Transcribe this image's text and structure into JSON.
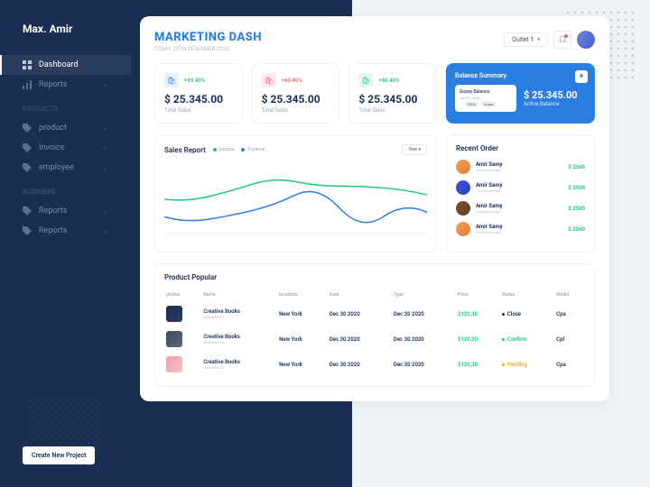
{
  "user": "Max. Amir",
  "nav": {
    "dashboard": "Dashboard",
    "reports1": "Reports",
    "sec_products": "PRODUCTS",
    "product": "product",
    "invoice": "Invoice",
    "employee": "employee",
    "sec_business": "BUSINESS",
    "reports2": "Reports",
    "reports3": "Reports",
    "new_project": "Create New Project"
  },
  "header": {
    "title": "MARKETING DASH",
    "subtitle": "TODAY, 29TH DESEMBER 2020",
    "outlet": "Outlet 1"
  },
  "stats": [
    {
      "pct": "+45.40%",
      "val": "$ 25.345.00",
      "lbl": "Total Sales"
    },
    {
      "pct": "+60.40%",
      "val": "$ 25.345.00",
      "lbl": "Total Sales"
    },
    {
      "pct": "+40.40%",
      "val": "$ 25.345.00",
      "lbl": "Total Sales"
    }
  ],
  "balance": {
    "title": "Balance Summary",
    "mini_title": "Gopay Balance",
    "mini_date": "Jan 01, 2020",
    "mini_chip1": "2500",
    "mini_chip2": "Gopay",
    "value": "$ 25.345.00",
    "label": "Active Balance"
  },
  "chart": {
    "title": "Sales Report",
    "leg1": "Income",
    "leg2": "Expense",
    "year": "Year"
  },
  "chart_data": {
    "type": "line",
    "x": [
      0,
      1,
      2,
      3,
      4,
      5,
      6,
      7,
      8,
      9,
      10,
      11
    ],
    "series": [
      {
        "name": "Income",
        "values": [
          40,
          38,
          45,
          52,
          62,
          60,
          65,
          63,
          60,
          55,
          58,
          50
        ]
      },
      {
        "name": "Expense",
        "values": [
          20,
          15,
          18,
          25,
          28,
          38,
          45,
          35,
          28,
          20,
          30,
          25
        ]
      }
    ],
    "ylim": [
      0,
      70
    ]
  },
  "orders": {
    "title": "Recent Order",
    "items": [
      {
        "name": "Amir Samy",
        "time": "15 minutes ago",
        "amt": "$ 2500"
      },
      {
        "name": "Amir Samy",
        "time": "15 minutes ago",
        "amt": "$ 2500"
      },
      {
        "name": "Amir Samy",
        "time": "15 minutes ago",
        "amt": "$ 2500"
      },
      {
        "name": "Amir Samy",
        "time": "15 minutes ago",
        "amt": "$ 2500"
      }
    ]
  },
  "table": {
    "title": "Product Popular",
    "cols": {
      "c0": "photos",
      "c1": "Name",
      "c2": "locations",
      "c3": "Date",
      "c4": "Type",
      "c5": "Price",
      "c6": "Status",
      "c7": "Model"
    },
    "rows": [
      {
        "name": "Creative Books",
        "id": "#200650610",
        "loc": "New York",
        "date": "Dec 30 2020",
        "type": "Dec 30 2020",
        "price": "$120,30",
        "status": "Close",
        "model": "Cpa"
      },
      {
        "name": "Creative Books",
        "id": "#200650610",
        "loc": "New York",
        "date": "Dec 30 2020",
        "type": "Dec 30 2020",
        "price": "$120,30",
        "status": "Confirm",
        "model": "Cpl"
      },
      {
        "name": "Creative Books",
        "id": "#200650610",
        "loc": "New York",
        "date": "Dec 30 2020",
        "type": "Dec 30 2020",
        "price": "$120,30",
        "status": "Pending",
        "model": "Cpa"
      }
    ]
  }
}
